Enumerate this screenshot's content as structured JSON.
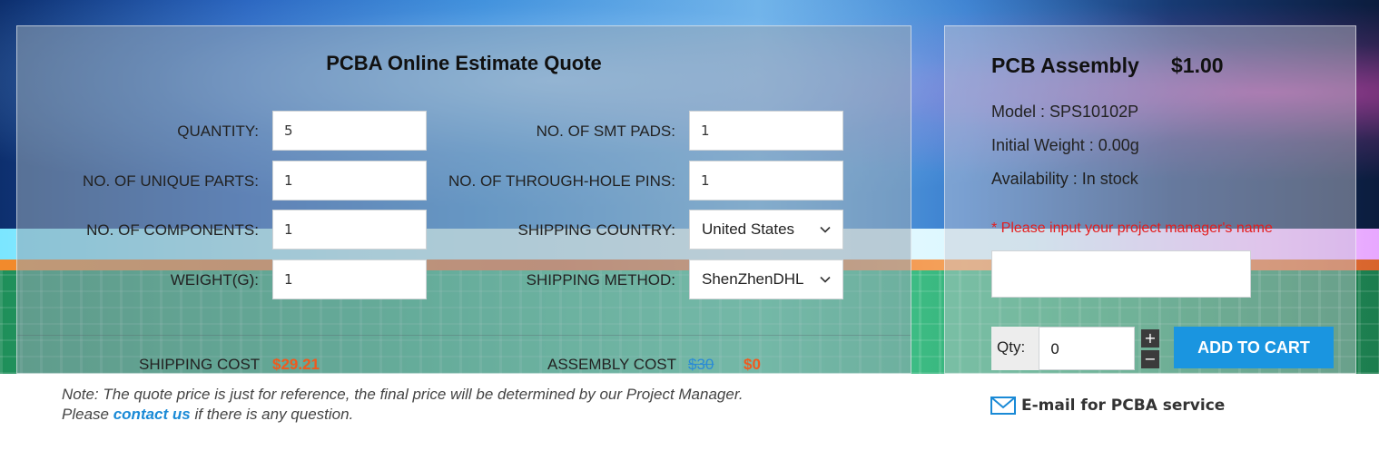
{
  "quote": {
    "title": "PCBA Online Estimate Quote",
    "fields": {
      "quantity": {
        "label": "QUANTITY:",
        "value": "5"
      },
      "unique_parts": {
        "label": "NO. OF UNIQUE PARTS:",
        "value": "1"
      },
      "components": {
        "label": "NO. OF COMPONENTS:",
        "value": "1"
      },
      "weight": {
        "label": "WEIGHT(G):",
        "value": "1"
      },
      "smt_pads": {
        "label": "NO. OF SMT PADS:",
        "value": "1"
      },
      "through_hole": {
        "label": "NO. OF THROUGH-HOLE PINS:",
        "value": "1"
      },
      "shipping_country": {
        "label": "SHIPPING COUNTRY:",
        "selected": "United States"
      },
      "shipping_method": {
        "label": "SHIPPING METHOD:",
        "selected": "ShenZhenDHL"
      }
    },
    "shipping_cost": {
      "label": "SHIPPING COST",
      "value": "$29.21"
    },
    "assembly_cost": {
      "label": "ASSEMBLY COST",
      "old_value": "$30",
      "value": "$0"
    }
  },
  "note": {
    "line1": "Note: The quote price is just for reference, the final price will be determined by our Project Manager.",
    "line2_before": "Please",
    "link": "contact us",
    "line2_after": "if there is any question."
  },
  "product": {
    "title": "PCB Assembly",
    "price": "$1.00",
    "model": "Model : SPS10102P",
    "weight": "Initial Weight : 0.00g",
    "availability": "Availability : In stock",
    "warning": "* Please input your project manager's name",
    "pm_name_value": "",
    "qty_label": "Qty:",
    "qty_value": "0",
    "plus": "+",
    "minus": "−",
    "add_to_cart": "ADD TO CART",
    "email_label": "E-mail for PCBA service"
  },
  "colors": {
    "accent": "#1a95e0",
    "price_orange": "#f05a1e",
    "warning_red": "#e31d1d",
    "link_blue": "#1a8ad6"
  },
  "icons": {
    "chevron": "chevron-down-icon",
    "mail": "mail-icon"
  }
}
